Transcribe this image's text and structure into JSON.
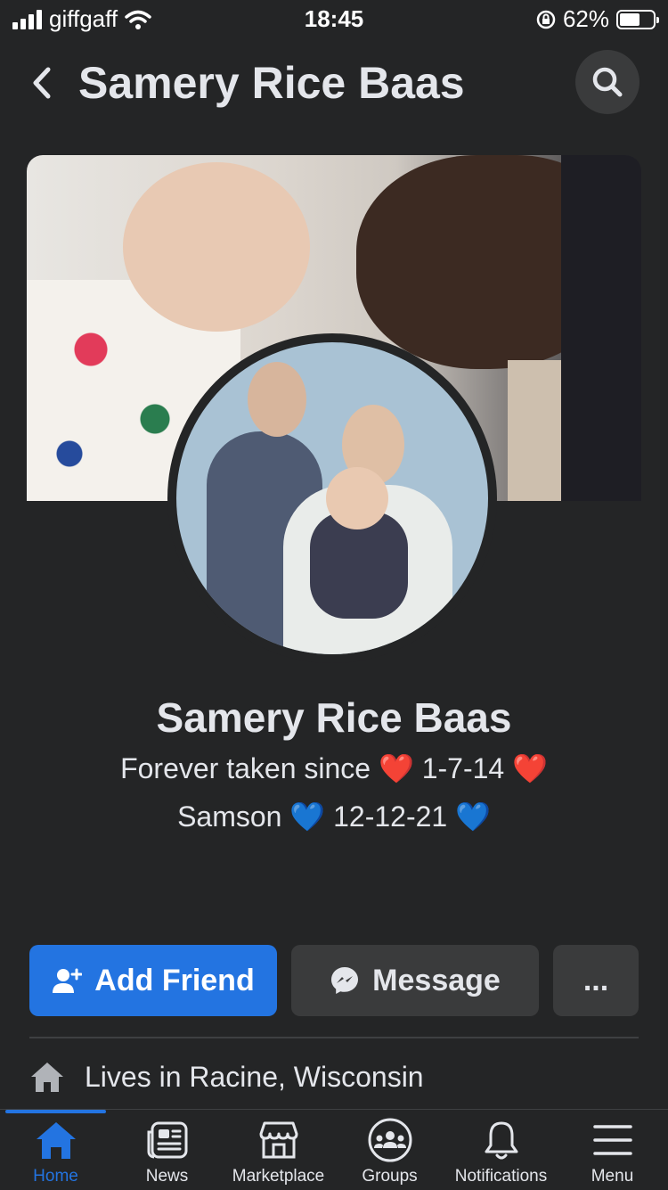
{
  "status_bar": {
    "carrier": "giffgaff",
    "time": "18:45",
    "battery": "62%",
    "battery_level": 0.62
  },
  "header": {
    "title": "Samery Rice Baas"
  },
  "profile": {
    "name": "Samery Rice Baas",
    "bio_line_1": "Forever taken since ❤️ 1-7-14 ❤️",
    "bio_line_2": "Samson 💙 12-12-21 💙"
  },
  "actions": {
    "add_friend": "Add Friend",
    "message": "Message",
    "more": "..."
  },
  "details": {
    "lives_in": "Lives in Racine, Wisconsin"
  },
  "tabbar": {
    "items": [
      {
        "label": "Home",
        "icon": "home-icon",
        "active": true
      },
      {
        "label": "News",
        "icon": "newspaper-icon"
      },
      {
        "label": "Marketplace",
        "icon": "shop-icon"
      },
      {
        "label": "Groups",
        "icon": "groups-icon"
      },
      {
        "label": "Notifications",
        "icon": "bell-icon"
      },
      {
        "label": "Menu",
        "icon": "menu-icon"
      }
    ]
  },
  "colors": {
    "background": "#242526",
    "accent": "#2374e1",
    "button_gray": "#3a3b3c"
  }
}
